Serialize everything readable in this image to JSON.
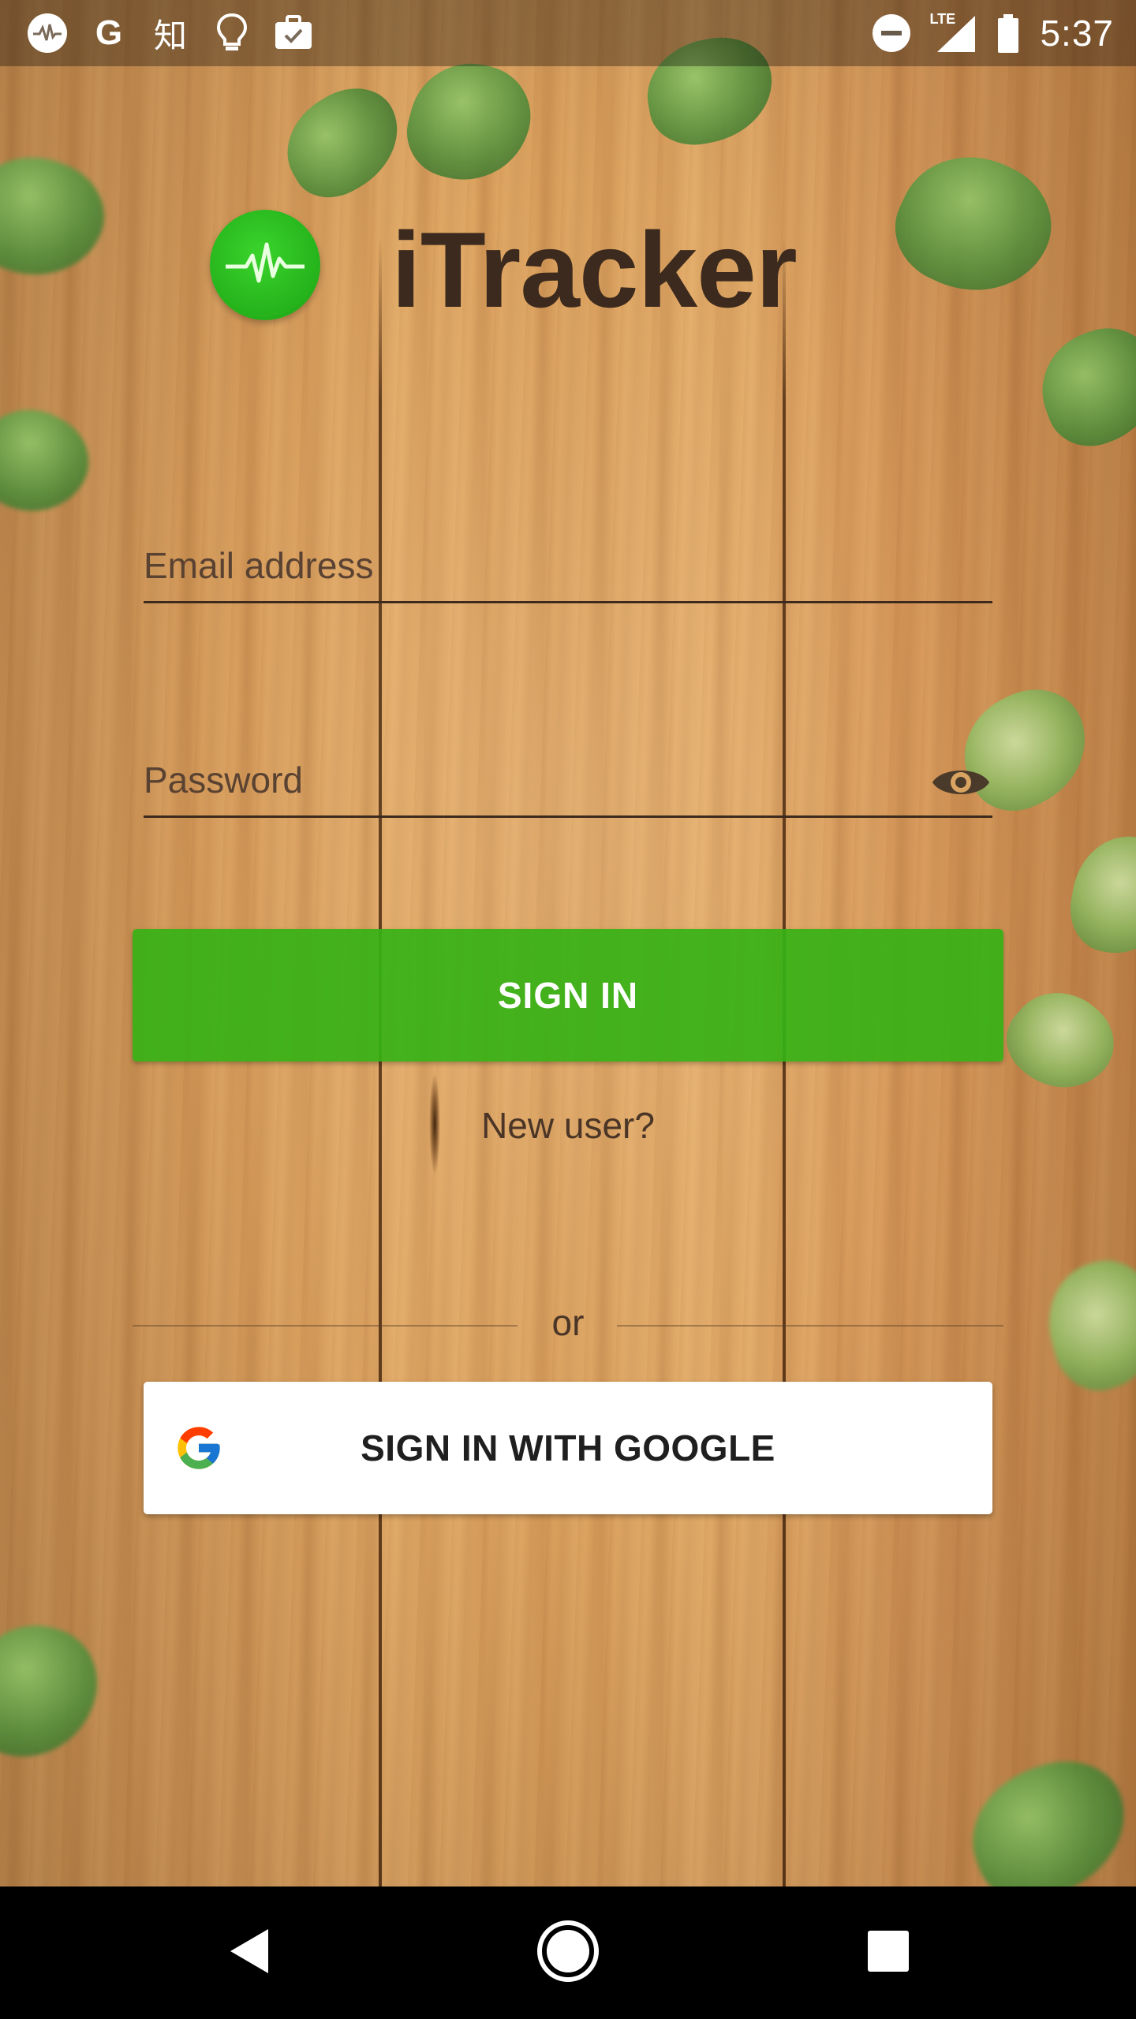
{
  "status_bar": {
    "time": "5:37",
    "network": "LTE",
    "left_icons": [
      "activity-icon",
      "google-icon",
      "zhihu-icon",
      "lightbulb-icon",
      "briefcase-check-icon"
    ],
    "right_icons": [
      "do-not-disturb-icon",
      "signal-icon",
      "battery-icon"
    ],
    "zhihu_glyph": "知",
    "google_glyph": "G"
  },
  "app": {
    "title": "iTracker",
    "brand_color": "#2fbf23"
  },
  "form": {
    "email_placeholder": "Email address",
    "email_value": "",
    "password_placeholder": "Password",
    "password_value": ""
  },
  "buttons": {
    "sign_in": "SIGN IN",
    "new_user": "New user?",
    "divider_text": "or",
    "google_sign_in": "SIGN IN WITH GOOGLE"
  },
  "nav": {
    "back": "back-icon",
    "home": "home-icon",
    "recents": "recents-icon"
  }
}
